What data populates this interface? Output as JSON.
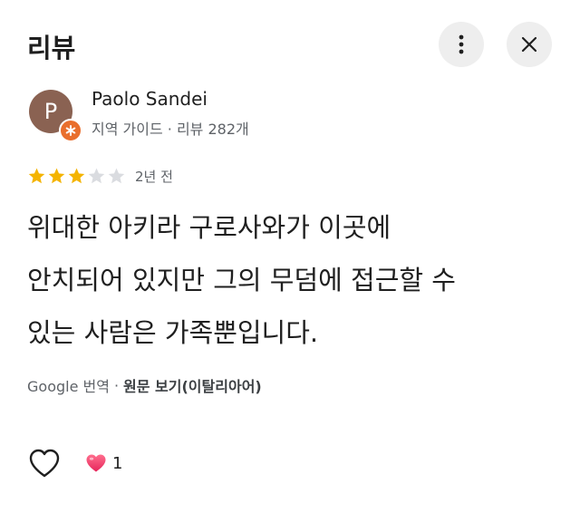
{
  "header": {
    "title": "리뷰",
    "more_icon": "more-vert-icon",
    "close_icon": "close-icon"
  },
  "reviewer": {
    "initial": "P",
    "name": "Paolo Sandei",
    "meta": "지역 가이드 · 리뷰 282개",
    "avatar_color": "#8a6252",
    "badge_color": "#e96f2d"
  },
  "review": {
    "rating": 3,
    "max_rating": 5,
    "date": "2년 전",
    "lines": [
      "위대한 아키라 구로사와가 이곳에",
      "안치되어 있지만 그의 무덤에 접근할 수",
      "있는 사람은 가족뿐입니다."
    ],
    "star_filled_color": "#f4b400",
    "star_empty_color": "#dadce0"
  },
  "translation": {
    "label": "Google 번역",
    "separator": "·",
    "original_link": "원문 보기(이탈리아어)"
  },
  "reactions": {
    "like_icon": "heart-outline-icon",
    "reaction_icon": "heart-emoji-icon",
    "count": "1"
  }
}
